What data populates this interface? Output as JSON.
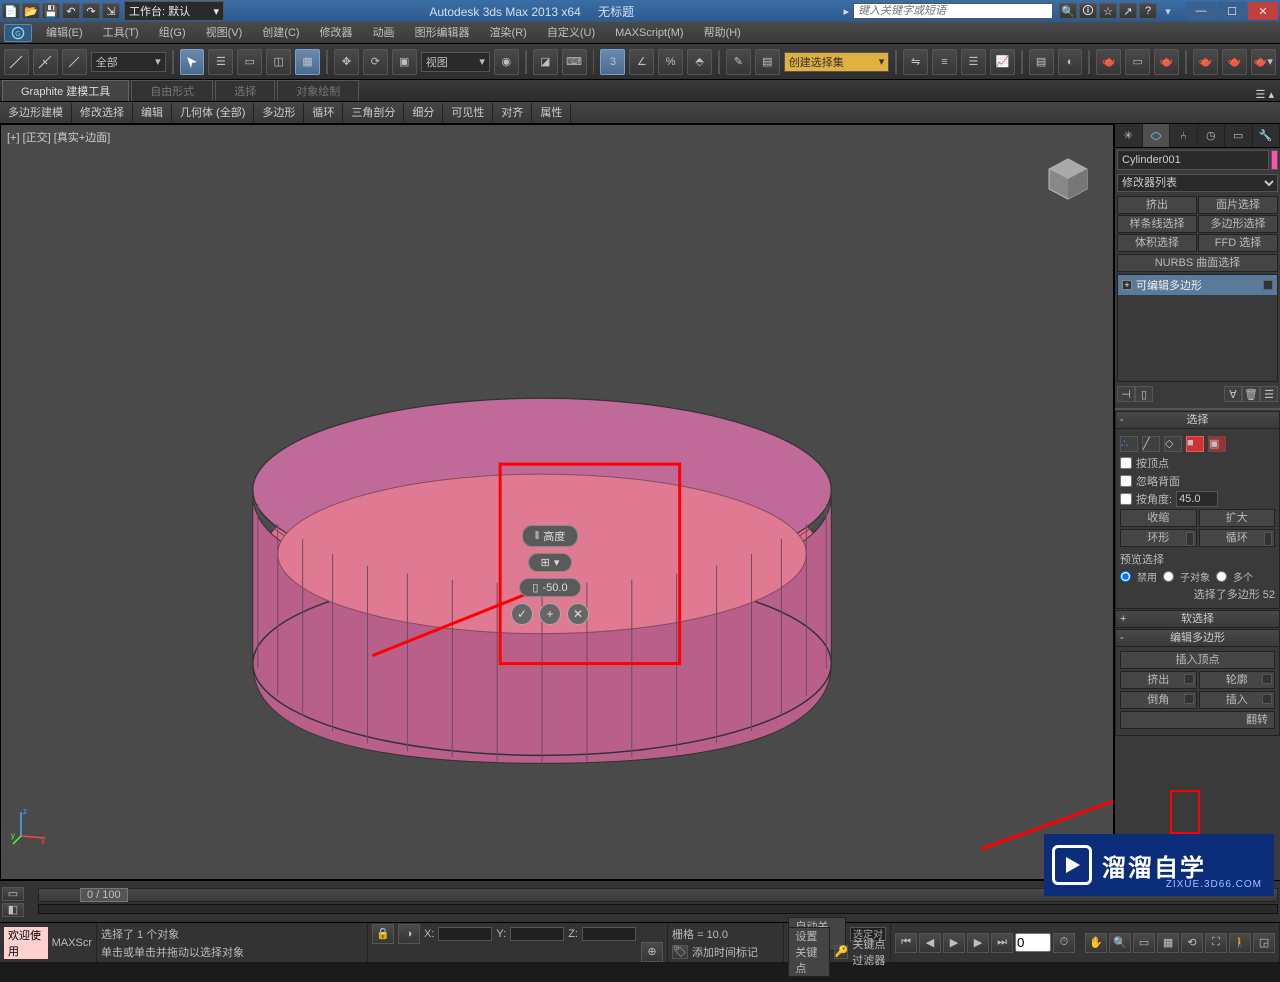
{
  "titlebar": {
    "workspace_label": "工作台: 默认",
    "app": "Autodesk 3ds Max  2013 x64",
    "untitled": "无标题",
    "search_placeholder": "键入关键字或短语"
  },
  "menus": [
    "编辑(E)",
    "工具(T)",
    "组(G)",
    "视图(V)",
    "创建(C)",
    "修改器",
    "动画",
    "图形编辑器",
    "渲染(R)",
    "自定义(U)",
    "MAXScript(M)",
    "帮助(H)"
  ],
  "toolbar": {
    "filter": "全部",
    "view": "视图"
  },
  "ribbon": {
    "tabs": [
      "Graphite 建模工具",
      "自由形式",
      "选择",
      "对象绘制"
    ],
    "groups": [
      "多边形建模",
      "修改选择",
      "编辑",
      "几何体 (全部)",
      "多边形",
      "循环",
      "三角剖分",
      "细分",
      "可见性",
      "对齐",
      "属性"
    ]
  },
  "viewport": {
    "label": "[+] [正交]  [真实+边面]"
  },
  "caddy": {
    "title": "高度",
    "value": "-50.0"
  },
  "panel": {
    "obj_name": "Cylinder001",
    "modlist": "修改器列表",
    "mod_btns": [
      "挤出",
      "面片选择",
      "样条线选择",
      "多边形选择",
      "体积选择",
      "FFD 选择"
    ],
    "nurbs": "NURBS 曲面选择",
    "stack_item": "可编辑多边形",
    "ro_select": "选择",
    "chk_byvert": "按顶点",
    "chk_ignback": "忽略背面",
    "chk_byangle": "按角度:",
    "angle_val": "45.0",
    "shrink": "收缩",
    "grow": "扩大",
    "ring": "环形",
    "loop": "循环",
    "preview_label": "预览选择",
    "radio_disable": "禁用",
    "radio_sub": "子对象",
    "radio_multi": "多个",
    "sel_status": "选择了多边形 52",
    "ro_soft": "软选择",
    "ro_editpoly": "编辑多边形",
    "ins_vert": "插入顶点",
    "extrude": "挤出",
    "outline": "轮廓",
    "bevel": "倒角",
    "inset": "插入",
    "flip": "翻转"
  },
  "time": {
    "slider": "0 / 100"
  },
  "status": {
    "welcome": "欢迎使用",
    "maxscr": "MAXScr",
    "line1": "选择了 1 个对象",
    "line2": "单击或单击并拖动以选择对象",
    "x": "X:",
    "y": "Y:",
    "z": "Z:",
    "grid": "栅格 = 10.0",
    "addtime": "添加时间标记",
    "autokey": "自动关键点",
    "setkey": "设置关键点",
    "selset": "选定对",
    "keyfilter": "关键点过滤器"
  },
  "watermark": {
    "main": "溜溜自学",
    "sub": "ZIXUE.3D66.COM"
  }
}
